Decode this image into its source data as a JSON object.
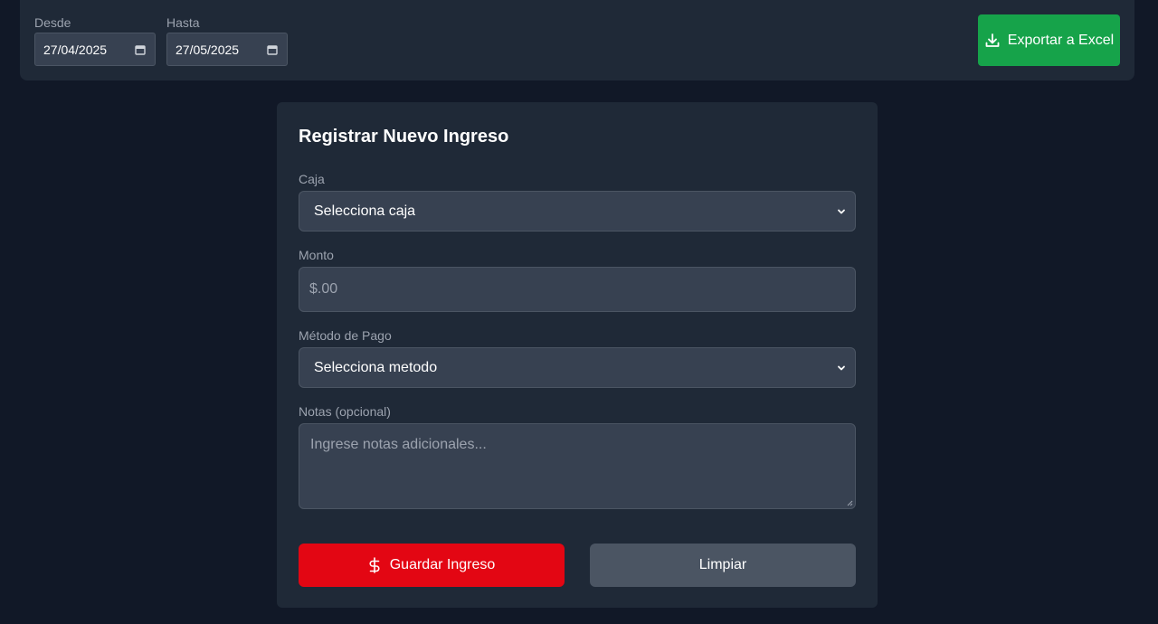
{
  "filters": {
    "from_label": "Desde",
    "from_value": "27/04/2025",
    "to_label": "Hasta",
    "to_value": "27/05/2025"
  },
  "export": {
    "label": "Exportar a Excel",
    "icon": "download-icon",
    "color": "#16a34a"
  },
  "form": {
    "title": "Registrar Nuevo Ingreso",
    "caja": {
      "label": "Caja",
      "selected": "Selecciona caja"
    },
    "monto": {
      "label": "Monto",
      "value": "$.00"
    },
    "metodo": {
      "label": "Método de Pago",
      "selected": "Selecciona metodo"
    },
    "notas": {
      "label": "Notas (opcional)",
      "placeholder": "Ingrese notas adicionales..."
    },
    "save": {
      "label": "Guardar Ingreso",
      "icon": "dollar-icon",
      "color": "#e30613"
    },
    "clear": {
      "label": "Limpiar"
    }
  }
}
